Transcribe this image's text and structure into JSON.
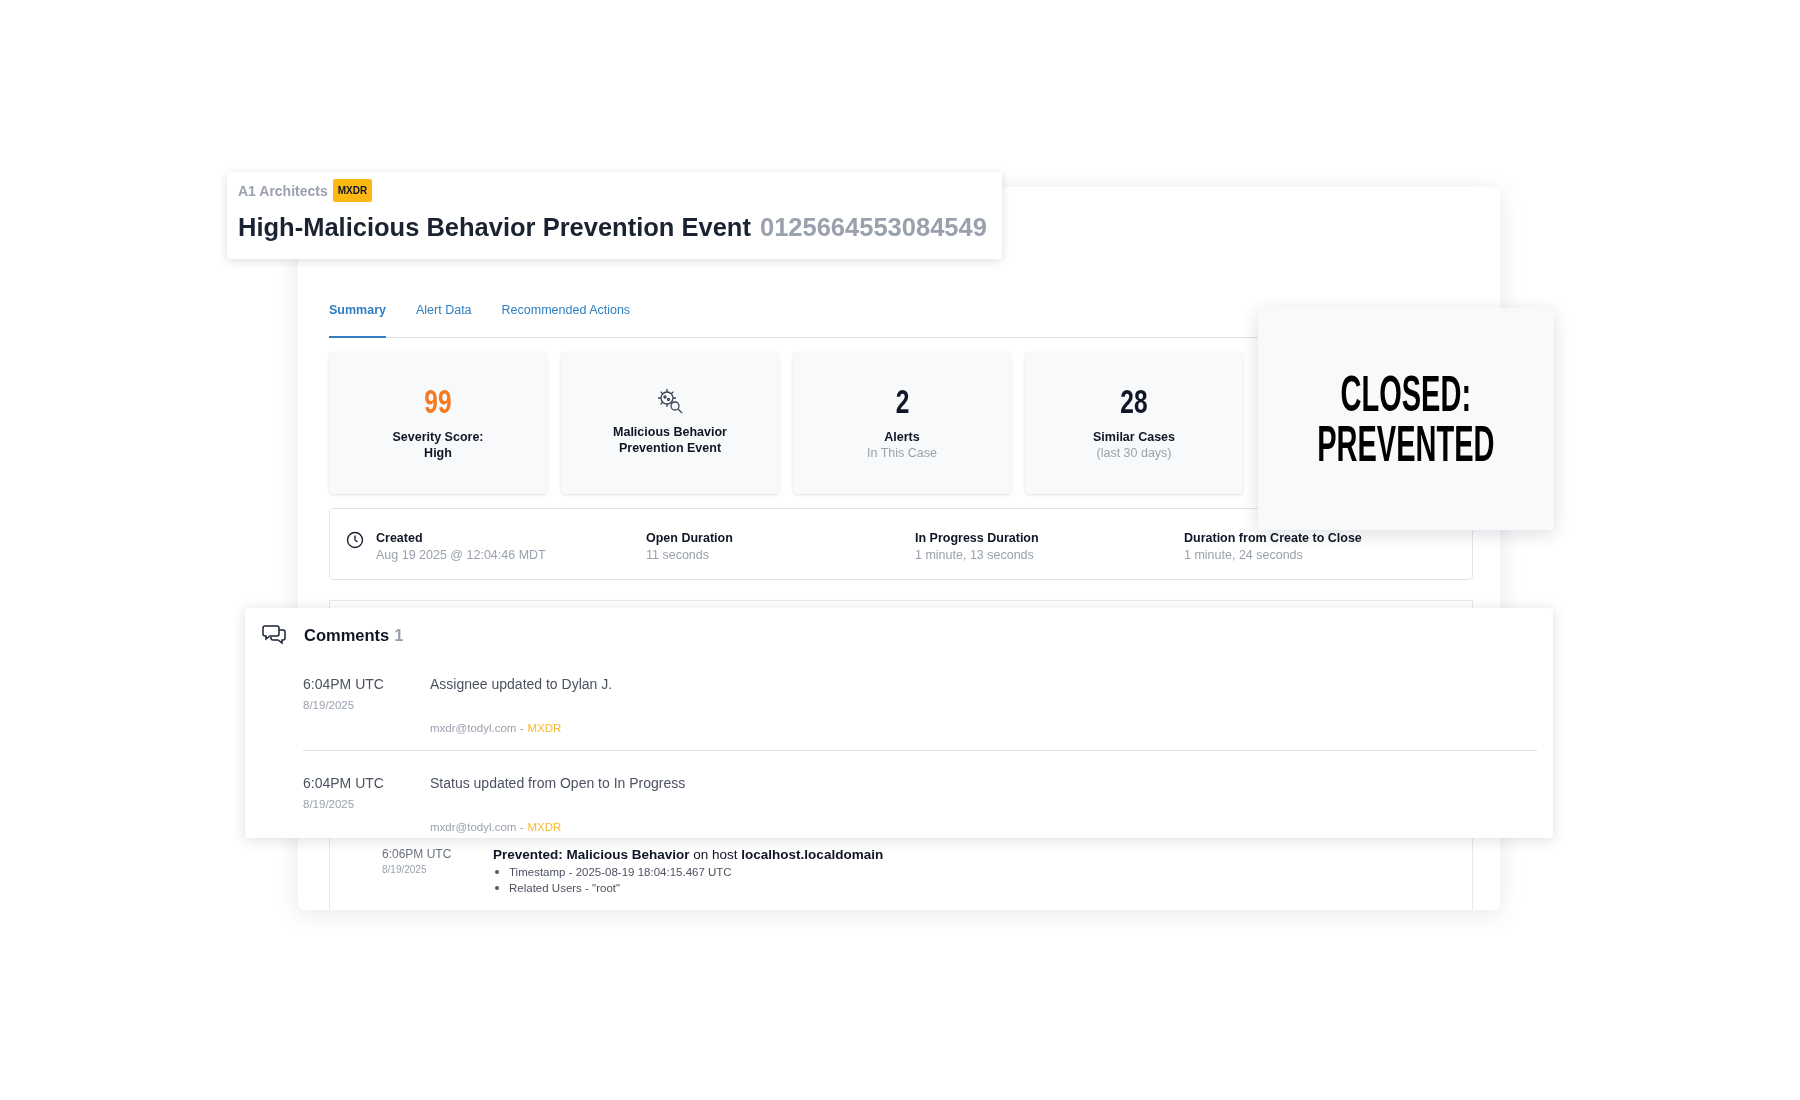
{
  "header": {
    "organization": "A1 Architects",
    "badge": "MXDR",
    "title": "High-Malicious Behavior Prevention Event",
    "case_id": "0125664553084549"
  },
  "tabs": [
    {
      "label": "Summary",
      "selected": true
    },
    {
      "label": "Alert Data",
      "selected": false
    },
    {
      "label": "Recommended Actions",
      "selected": false
    }
  ],
  "stats": [
    {
      "kind": "number",
      "value": "99",
      "color": "#f47b20",
      "label": "Severity Score:",
      "detail": "High",
      "muted": false
    },
    {
      "kind": "icon",
      "label": "Malicious Behavior",
      "detail": "Prevention Event",
      "muted": false
    },
    {
      "kind": "number",
      "value": "2",
      "color": "#0f1626",
      "label": "Alerts",
      "detail": "In This Case",
      "muted": true
    },
    {
      "kind": "number",
      "value": "28",
      "color": "#0f1626",
      "label": "Similar Cases",
      "detail": "(last 30 days)",
      "muted": true
    }
  ],
  "durations": [
    {
      "label": "Created",
      "value": "Aug 19 2025 @ 12:04:46 MDT"
    },
    {
      "label": "Open Duration",
      "value": "11 seconds"
    },
    {
      "label": "In Progress Duration",
      "value": "1 minute, 13 seconds"
    },
    {
      "label": "Duration from Create to Close",
      "value": "1 minute, 24 seconds"
    }
  ],
  "status_card": {
    "lines": [
      "CLOSED:",
      "PREVENTED"
    ]
  },
  "comments": {
    "title": "Comments",
    "count": "1",
    "entries": [
      {
        "time": "6:04PM UTC",
        "date": "8/19/2025",
        "text": "Assignee updated to Dylan J.",
        "author": "mxdr@todyl.com -",
        "source": "MXDR"
      },
      {
        "time": "6:04PM UTC",
        "date": "8/19/2025",
        "text": "Status updated from Open to In Progress",
        "author": "mxdr@todyl.com -",
        "source": "MXDR"
      }
    ]
  },
  "timeline": [
    {
      "time": "6:06PM UTC",
      "date": "8/19/2025",
      "text": "**Prevented: Malicious Behavior** on host **localhost.localdomain**",
      "details": [
        "Timestamp - 2025-08-19 18:04:15.467 UTC",
        "Related Users - \"root\""
      ]
    }
  ]
}
